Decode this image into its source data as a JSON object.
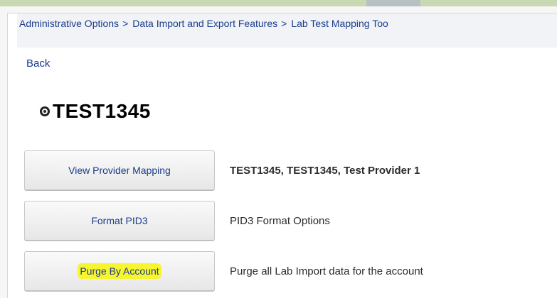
{
  "breadcrumb": {
    "items": [
      {
        "label": "Administrative Options",
        "sep": ">"
      },
      {
        "label": "Data Import and Export Features",
        "sep": ">"
      },
      {
        "label": "Lab Test Mapping Too",
        "sep": ""
      }
    ]
  },
  "back_label": "Back",
  "page_title": "TEST1345",
  "title_icon": "radio-target-icon",
  "actions": [
    {
      "button": "View Provider Mapping",
      "description": "TEST1345, TEST1345, Test Provider 1"
    },
    {
      "button": "Format PID3",
      "description": "PID3 Format Options"
    },
    {
      "button": "Purge By Account",
      "description": "Purge all Lab Import data for the account",
      "highlighted": true
    }
  ],
  "colors": {
    "link": "#1a3c8c",
    "highlight": "#f7f430",
    "top_bar": "#c9d9b3"
  }
}
